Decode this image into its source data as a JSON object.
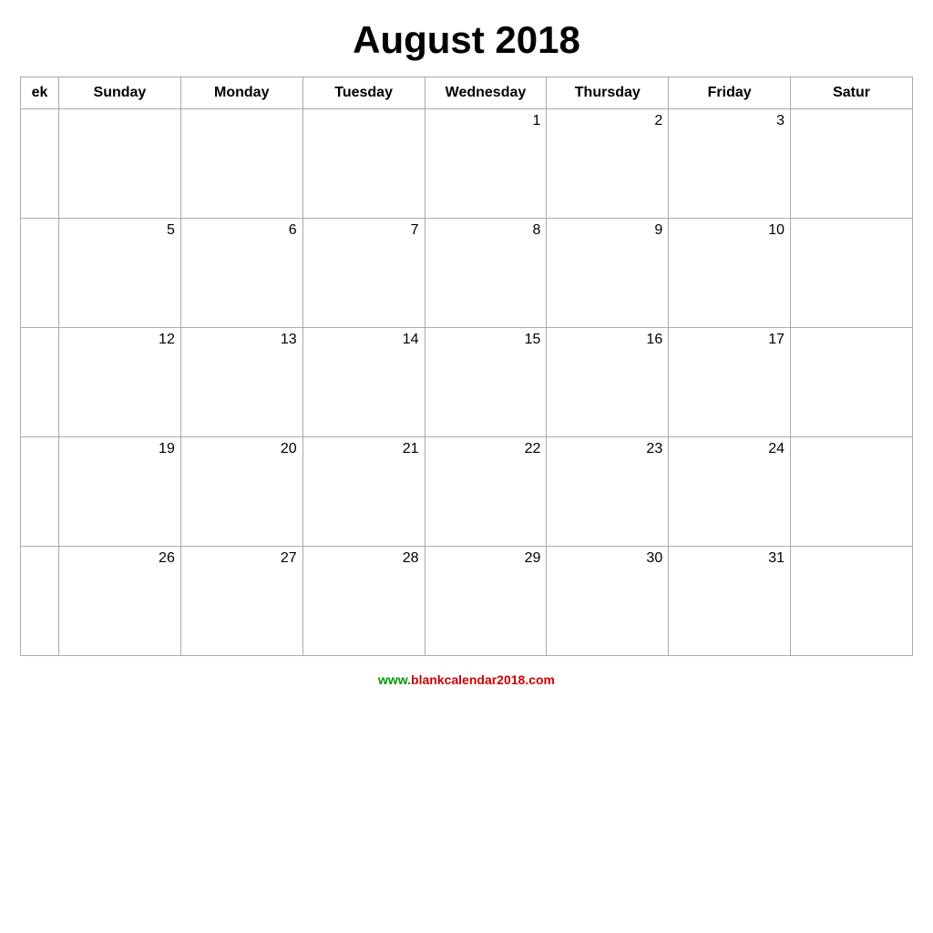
{
  "calendar": {
    "title": "August 2018",
    "headers": [
      "ek",
      "Sunday",
      "Monday",
      "Tuesday",
      "Wednesday",
      "Thursday",
      "Friday",
      "Satur"
    ],
    "weeks": [
      {
        "days": [
          "",
          "",
          "",
          "",
          "1",
          "2",
          "3",
          ""
        ]
      },
      {
        "days": [
          "",
          "5",
          "6",
          "7",
          "8",
          "9",
          "10",
          ""
        ]
      },
      {
        "days": [
          "",
          "12",
          "13",
          "14",
          "15",
          "16",
          "17",
          ""
        ]
      },
      {
        "days": [
          "",
          "19",
          "20",
          "21",
          "22",
          "23",
          "24",
          ""
        ]
      },
      {
        "days": [
          "",
          "26",
          "27",
          "28",
          "29",
          "30",
          "31",
          ""
        ]
      }
    ],
    "footer_url": "www.blankcalendar2018.com"
  }
}
